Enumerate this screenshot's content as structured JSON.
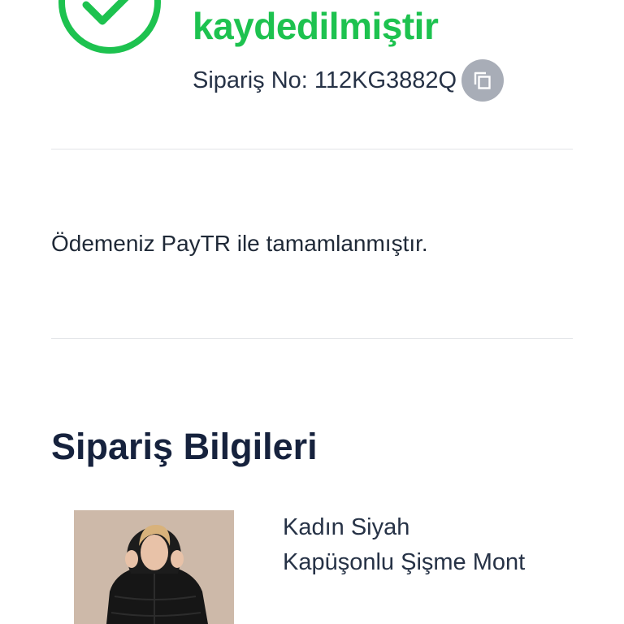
{
  "confirmation": {
    "title": "kaydedilmiştir",
    "order_number_text": "Sipariş No: 112KG3882Q",
    "icon": "check-circle-icon",
    "copy_icon": "copy-icon"
  },
  "payment": {
    "message": "Ödemeniz PayTR ile tamamlanmıştır."
  },
  "order_info": {
    "heading": "Sipariş Bilgileri",
    "items": [
      {
        "name": "Kadın Siyah Kapüşonlu Şişme Mont"
      }
    ]
  },
  "colors": {
    "success_green": "#1dc24f",
    "heading_navy": "#16223d",
    "text_dark": "#263246",
    "copy_button_gray": "#a8adb7",
    "divider": "#e3e5e8"
  }
}
